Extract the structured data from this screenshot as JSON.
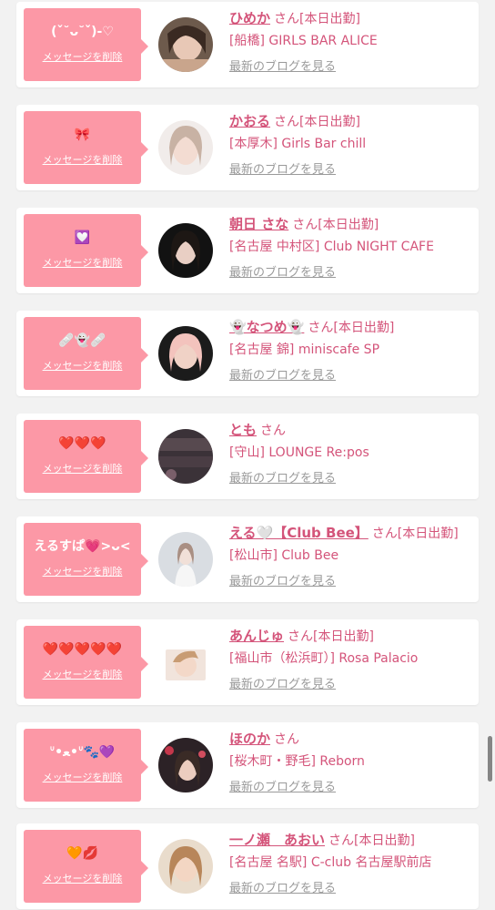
{
  "delete_label": "メッセージを削除",
  "san_label": "さん",
  "blog_label": "最新のブログを見る",
  "cards": [
    {
      "message": "(ˇ˘ᴗ˘ˇ)-♡",
      "name": "ひめか",
      "status": "[本日出勤]",
      "shop": "[船橋] GIRLS BAR ALICE"
    },
    {
      "message": "🎀",
      "name": "かおる",
      "status": "[本日出勤]",
      "shop": "[本厚木] Girls Bar chill"
    },
    {
      "message": "💟",
      "name": "朝日 さな",
      "status": "[本日出勤]",
      "shop": "[名古屋 中村区] Club NIGHT CAFE"
    },
    {
      "message": "🩹👻🩹",
      "name": "👻なつめ👻",
      "status": "[本日出勤]",
      "shop": "[名古屋 錦] miniscafe SP"
    },
    {
      "message": "❤️❤️❤️",
      "name": "とも",
      "status": "",
      "shop": "[守山] LOUNGE Re:pos"
    },
    {
      "message": "えるすぱ💗>ᴗ<",
      "name": "える🤍【Club Bee】",
      "status": "[本日出勤]",
      "shop": "[松山市] Club Bee"
    },
    {
      "message": "❤️❤️❤️❤️❤️",
      "name": "あんじゅ",
      "status": "[本日出勤]",
      "shop": "[福山市（松浜町）] Rosa Palacio"
    },
    {
      "message": "ᐡ•ﻌ•ᐡ🐾💜",
      "name": "ほのか",
      "status": "",
      "shop": "[桜木町・野毛] Reborn"
    },
    {
      "message": "🧡💋",
      "name": "一ノ瀬　あおい",
      "status": "[本日出勤]",
      "shop": "[名古屋 名駅] C-club 名古屋駅前店"
    }
  ],
  "colors": {
    "accent": "#d4547a",
    "bubble": "#fc98a6",
    "blog_link": "#9a9a9a",
    "background": "#f2f2f2"
  }
}
